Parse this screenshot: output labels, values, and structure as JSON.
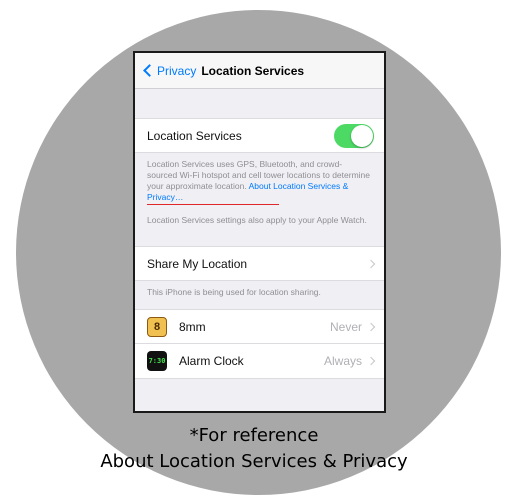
{
  "navbar": {
    "back_label": "Privacy",
    "title": "Location Services"
  },
  "location_services": {
    "label": "Location Services",
    "enabled": true
  },
  "description": {
    "text": "Location Services uses GPS, Bluetooth, and crowd-sourced Wi-Fi hotspot and cell tower locations to determine your approximate location. ",
    "link": "About Location Services & Privacy…",
    "watch_note": "Location Services settings also apply to your Apple Watch."
  },
  "share": {
    "label": "Share My Location",
    "note": "This iPhone is being used for location sharing."
  },
  "apps": [
    {
      "name": "8mm",
      "icon_text": "8",
      "value": "Never"
    },
    {
      "name": "Alarm Clock",
      "icon_text": "7:30",
      "value": "Always"
    }
  ],
  "caption": {
    "line1": "*For reference",
    "line2": "About Location Services & Privacy"
  },
  "colors": {
    "accent": "#007aff",
    "toggle_on": "#4cd964",
    "highlight_underline": "#e0282a",
    "backdrop": "#a8a8a8"
  }
}
